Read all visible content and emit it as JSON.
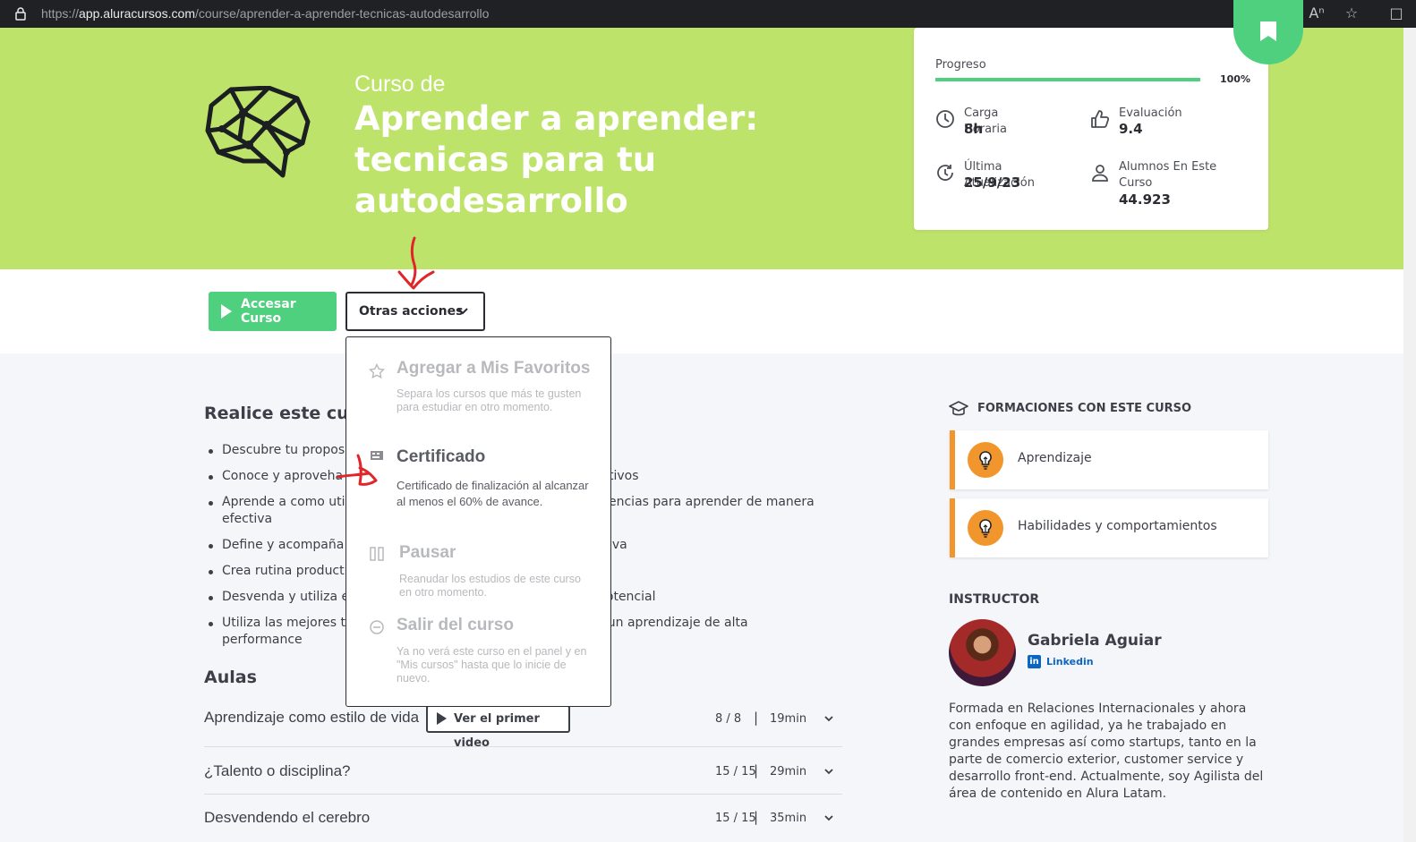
{
  "browser": {
    "url_scheme": "https://",
    "url_host": "app.aluracursos.com",
    "url_path": "/course/aprender-a-aprender-tecnicas-autodesarrollo",
    "icons": [
      "lock-icon",
      "read-aloud-icon",
      "favorite-star-icon",
      "split-screen-icon"
    ]
  },
  "hero": {
    "pre_title": "Curso de",
    "title": "Aprender a aprender: tecnicas para tu autodesarrollo",
    "logo_icon": "brain-icon",
    "background_color": "#bee36a"
  },
  "stats": {
    "progress_label": "Progreso",
    "progress_value": "100%",
    "progress_fraction": 1.0,
    "carga_label": "Carga Horaria",
    "carga_value": "8h",
    "evaluacion_label": "Evaluación",
    "evaluacion_value": "9.4",
    "update_label": "Última Atualización",
    "update_value": "25/9/23",
    "alumnos_label": "Alumnos En Este Curso",
    "alumnos_value": "44.923"
  },
  "actions": {
    "access_label": "Accesar Curso",
    "other_label": "Otras acciones"
  },
  "dropdown": {
    "items": [
      {
        "title": "Agregar a Mis Favoritos",
        "desc": "Separa los cursos que más te gusten para estudiar en otro momento.",
        "icon": "star-icon"
      },
      {
        "title": "Certificado",
        "desc": "Certificado de finalización al alcanzar al menos el 60% de avance.",
        "icon": "certificate-icon"
      },
      {
        "title": "Pausar",
        "desc": "Reanudar los estudios de este curso en otro momento.",
        "icon": "pause-icon"
      },
      {
        "title": "Salir del curso",
        "desc": "Ya no verá este curso en el panel y en \"Mis cursos\" hasta que lo inicie de nuevo.",
        "icon": "minus-circle-icon"
      }
    ]
  },
  "objectives": {
    "heading": "Realice este curs",
    "items": [
      {
        "a": "Descubre tu proposit",
        "b": ""
      },
      {
        "a": "Conoce y aproveha e",
        "b": "tivos"
      },
      {
        "a": "Aprende a como utiliz",
        "b": "encias para aprender de manera"
      },
      {
        "a": "efectiva",
        "b": ""
      },
      {
        "a": "Define y acompaña tu",
        "b": "iva"
      },
      {
        "a": "Crea rutina productiv",
        "b": ""
      },
      {
        "a": "Desvenda y utiliza el p",
        "b": "potencial"
      },
      {
        "a": "Utiliza las mejores tec",
        "b": "ra un aprendizaje de alta"
      },
      {
        "a": "performance",
        "b": ""
      }
    ]
  },
  "aulas": {
    "heading": "Aulas",
    "first_video_label": "Ver el primer video",
    "rows": [
      {
        "name": "Aprendizaje como estilo de vida",
        "count": "8 / 8",
        "sep": "|",
        "duration": "19min"
      },
      {
        "name": "¿Talento o disciplina?",
        "count": "15 / 15",
        "sep": "|",
        "duration": "29min"
      },
      {
        "name": "Desvendendo el cerebro",
        "count": "15 / 15",
        "sep": "|",
        "duration": "35min"
      }
    ]
  },
  "formaciones": {
    "heading": "FORMACIONES CON ESTE CURSO",
    "accent_color": "#f1952d",
    "items": [
      {
        "name": "Aprendizaje",
        "icon": "lightbulb-icon"
      },
      {
        "name": "Habilidades y comportamientos",
        "icon": "lightbulb-icon"
      }
    ]
  },
  "instructor": {
    "heading": "INSTRUCTOR",
    "name": "Gabriela Aguiar",
    "link_label": "Linkedin",
    "bio": "Formada en Relaciones Internacionales y ahora con enfoque en agilidad, ya he trabajado en grandes empresas así como startups, tanto en la parte de comercio exterior, customer service y desarrollo front-end. Actualmente, soy Agilista del área de contenido en Alura Latam."
  },
  "colors": {
    "accent_green": "#4fd07f",
    "annotation_red": "#e0262a"
  }
}
